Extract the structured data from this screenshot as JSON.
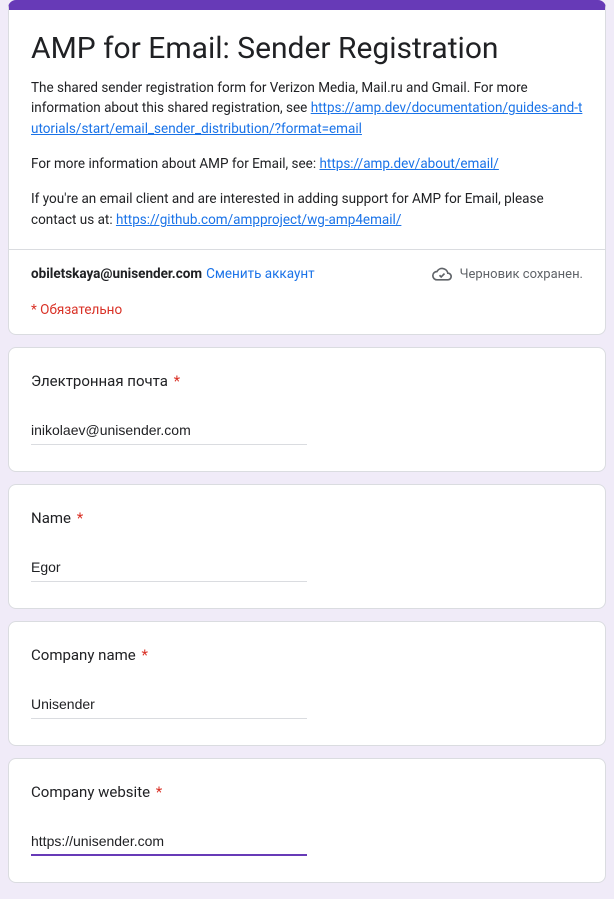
{
  "header": {
    "title": "AMP for Email: Sender Registration",
    "desc_intro": "The shared sender registration form for Verizon Media, Mail.ru and Gmail. For more information about this shared registration, see ",
    "desc_intro_link": "https://amp.dev/documentation/guides-and-tutorials/start/email_sender_distribution/?format=email",
    "desc_more_prefix": "For more information about AMP for Email, see: ",
    "desc_more_link": "https://amp.dev/about/email/",
    "desc_contact_prefix": "If you're an email client and are interested in adding support for AMP for Email, please contact us at: ",
    "desc_contact_link": "https://github.com/ampproject/wg-amp4email/"
  },
  "account": {
    "email": "obiletskaya@unisender.com",
    "switch_label": "Сменить аккаунт",
    "draft_saved": "Черновик сохранен.",
    "required_note": "* Обязательно"
  },
  "questions": [
    {
      "label": "Электронная почта",
      "value": "inikolaev@unisender.com",
      "focused": false
    },
    {
      "label": "Name",
      "value": "Egor",
      "focused": false
    },
    {
      "label": "Company name",
      "value": "Unisender",
      "focused": false
    },
    {
      "label": "Company website",
      "value": "https://unisender.com",
      "focused": true
    }
  ],
  "asterisk": "*"
}
